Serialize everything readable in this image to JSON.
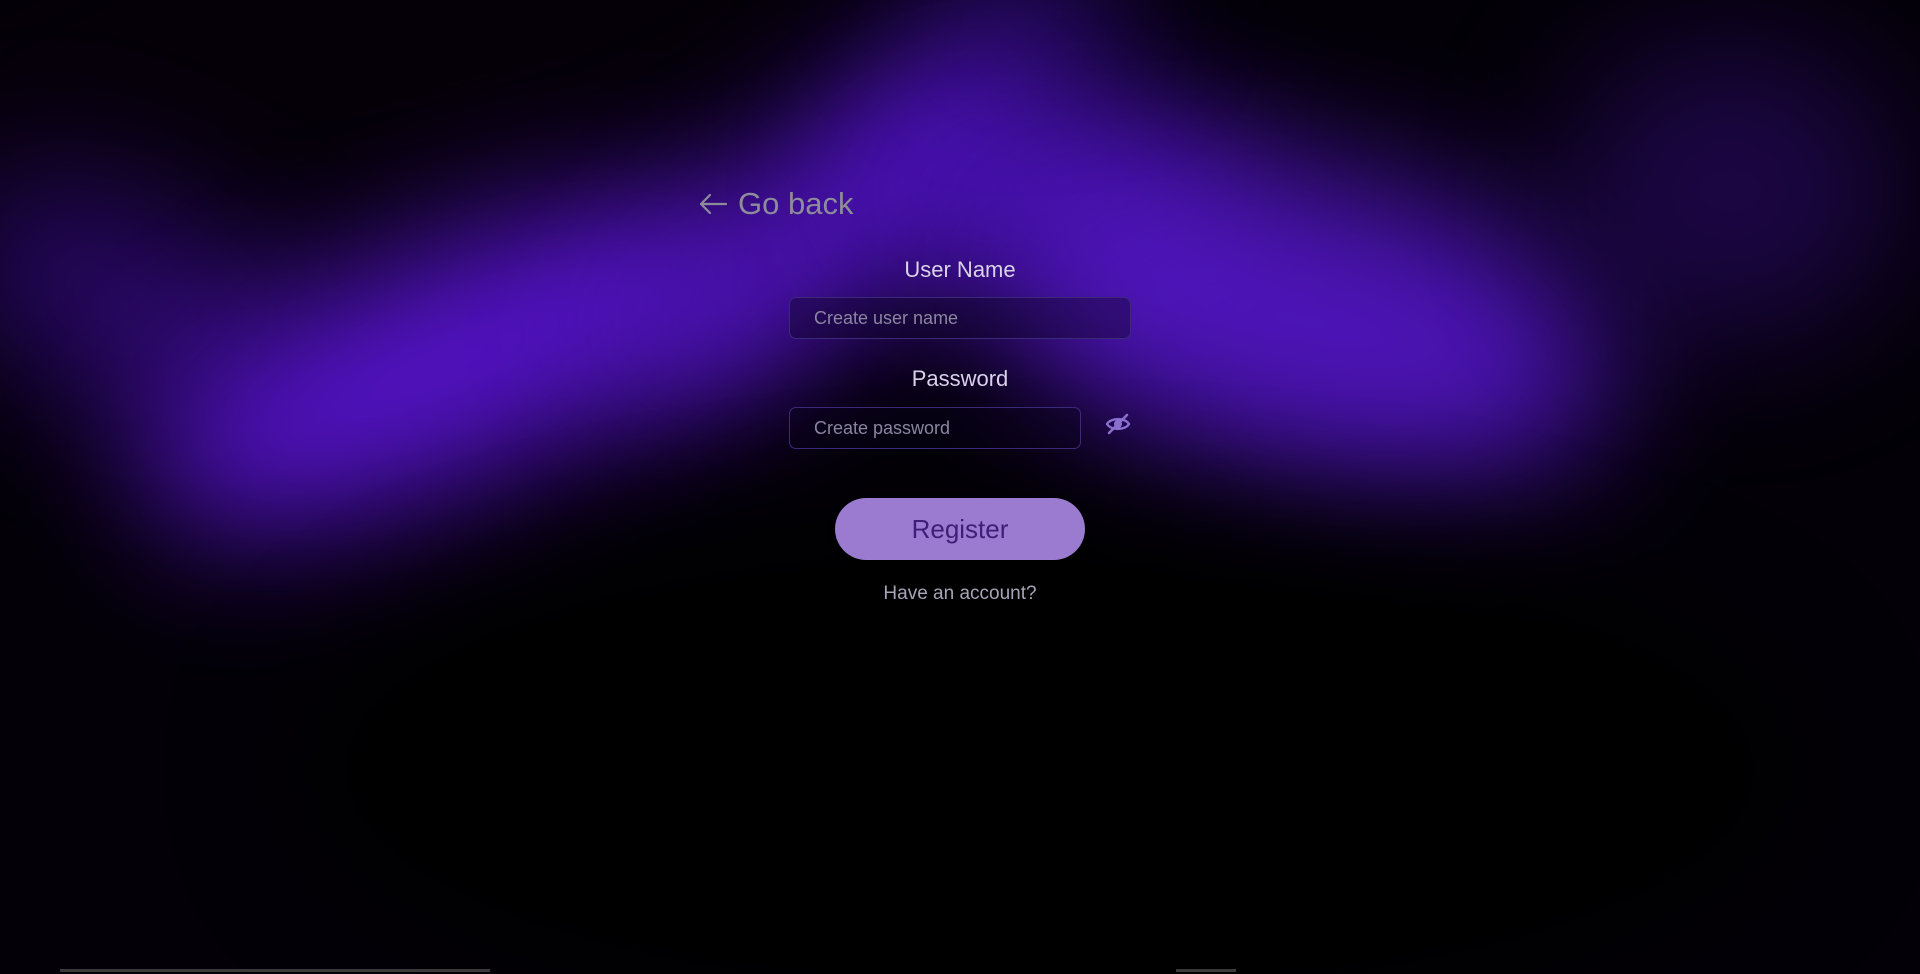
{
  "nav": {
    "back_label": "Go back",
    "back_icon": "arrow-left-icon"
  },
  "form": {
    "username_label": "User Name",
    "username_placeholder": "Create user name",
    "username_value": "",
    "password_label": "Password",
    "password_placeholder": "Create password",
    "password_value": "",
    "password_toggle_icon": "eye-off-icon",
    "register_label": "Register",
    "login_link": "Have an account?"
  },
  "colors": {
    "accent": "#9a7bd0",
    "accent_text": "#3d1f78",
    "background_glow": "#5a14d4",
    "icon": "#8b6fd0"
  }
}
